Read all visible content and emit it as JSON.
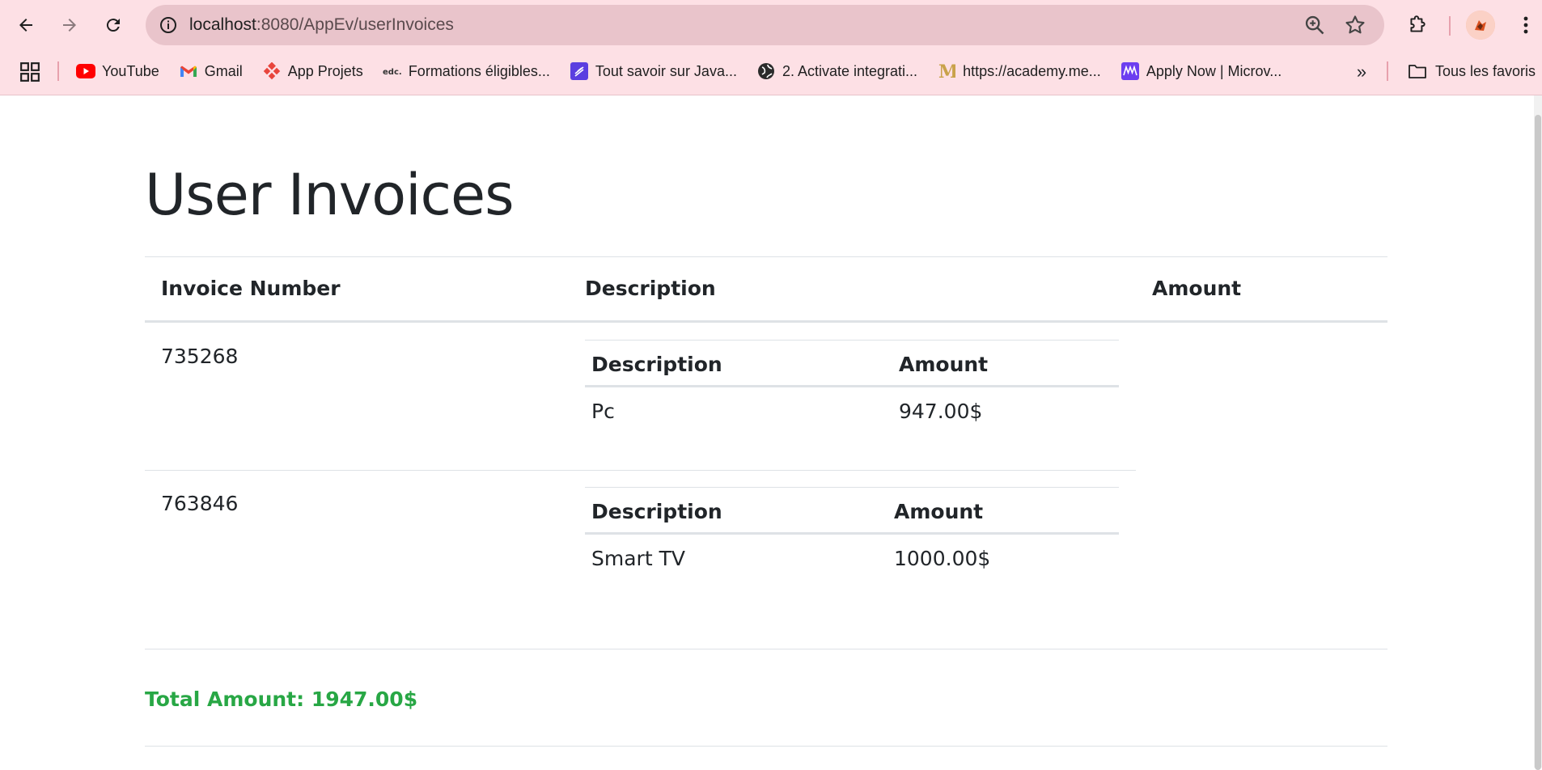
{
  "browser": {
    "url_host": "localhost",
    "url_path": ":8080/AppEv/userInvoices",
    "bookmarks": [
      {
        "label": "YouTube",
        "icon": "youtube-icon"
      },
      {
        "label": "Gmail",
        "icon": "gmail-icon"
      },
      {
        "label": "App Projets",
        "icon": "app-projets-icon"
      },
      {
        "label": "Formations éligibles...",
        "icon": "edc-icon"
      },
      {
        "label": "Tout savoir sur Java...",
        "icon": "java-site-icon"
      },
      {
        "label": "2. Activate integrati...",
        "icon": "globe-icon"
      },
      {
        "label": "https://academy.me...",
        "icon": "academy-icon"
      },
      {
        "label": "Apply Now | Microv...",
        "icon": "microverse-icon"
      }
    ],
    "more_label": "»",
    "all_bookmarks_label": "Tous les favoris"
  },
  "page": {
    "title": "User Invoices",
    "columns": [
      "Invoice Number",
      "Description",
      "Amount"
    ],
    "invoices": [
      {
        "number": "735268",
        "items_header": {
          "description": "Description",
          "amount": "Amount"
        },
        "items": [
          {
            "description": "Pc",
            "amount": "947.00$"
          }
        ]
      },
      {
        "number": "763846",
        "items_header": {
          "description": "Description",
          "amount": "Amount"
        },
        "items": [
          {
            "description": "Smart TV",
            "amount": "1000.00$"
          }
        ]
      }
    ],
    "total": "Total Amount: 1947.00$"
  },
  "colors": {
    "chrome_bg": "#fde0e5",
    "omnibox_bg": "#e9c4cb",
    "total_green": "#28a745",
    "text": "#212529"
  }
}
